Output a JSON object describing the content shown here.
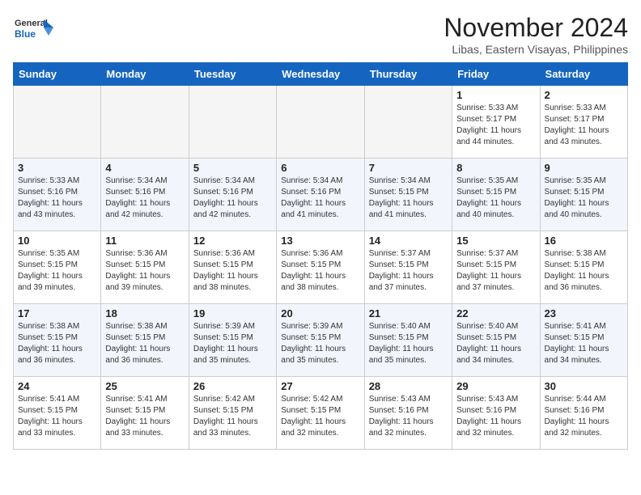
{
  "header": {
    "logo_general": "General",
    "logo_blue": "Blue",
    "month_title": "November 2024",
    "location": "Libas, Eastern Visayas, Philippines"
  },
  "weekdays": [
    "Sunday",
    "Monday",
    "Tuesday",
    "Wednesday",
    "Thursday",
    "Friday",
    "Saturday"
  ],
  "rows": [
    {
      "cells": [
        {
          "day": "",
          "info": ""
        },
        {
          "day": "",
          "info": ""
        },
        {
          "day": "",
          "info": ""
        },
        {
          "day": "",
          "info": ""
        },
        {
          "day": "",
          "info": ""
        },
        {
          "day": "1",
          "info": "Sunrise: 5:33 AM\nSunset: 5:17 PM\nDaylight: 11 hours\nand 44 minutes."
        },
        {
          "day": "2",
          "info": "Sunrise: 5:33 AM\nSunset: 5:17 PM\nDaylight: 11 hours\nand 43 minutes."
        }
      ]
    },
    {
      "cells": [
        {
          "day": "3",
          "info": "Sunrise: 5:33 AM\nSunset: 5:16 PM\nDaylight: 11 hours\nand 43 minutes."
        },
        {
          "day": "4",
          "info": "Sunrise: 5:34 AM\nSunset: 5:16 PM\nDaylight: 11 hours\nand 42 minutes."
        },
        {
          "day": "5",
          "info": "Sunrise: 5:34 AM\nSunset: 5:16 PM\nDaylight: 11 hours\nand 42 minutes."
        },
        {
          "day": "6",
          "info": "Sunrise: 5:34 AM\nSunset: 5:16 PM\nDaylight: 11 hours\nand 41 minutes."
        },
        {
          "day": "7",
          "info": "Sunrise: 5:34 AM\nSunset: 5:15 PM\nDaylight: 11 hours\nand 41 minutes."
        },
        {
          "day": "8",
          "info": "Sunrise: 5:35 AM\nSunset: 5:15 PM\nDaylight: 11 hours\nand 40 minutes."
        },
        {
          "day": "9",
          "info": "Sunrise: 5:35 AM\nSunset: 5:15 PM\nDaylight: 11 hours\nand 40 minutes."
        }
      ]
    },
    {
      "cells": [
        {
          "day": "10",
          "info": "Sunrise: 5:35 AM\nSunset: 5:15 PM\nDaylight: 11 hours\nand 39 minutes."
        },
        {
          "day": "11",
          "info": "Sunrise: 5:36 AM\nSunset: 5:15 PM\nDaylight: 11 hours\nand 39 minutes."
        },
        {
          "day": "12",
          "info": "Sunrise: 5:36 AM\nSunset: 5:15 PM\nDaylight: 11 hours\nand 38 minutes."
        },
        {
          "day": "13",
          "info": "Sunrise: 5:36 AM\nSunset: 5:15 PM\nDaylight: 11 hours\nand 38 minutes."
        },
        {
          "day": "14",
          "info": "Sunrise: 5:37 AM\nSunset: 5:15 PM\nDaylight: 11 hours\nand 37 minutes."
        },
        {
          "day": "15",
          "info": "Sunrise: 5:37 AM\nSunset: 5:15 PM\nDaylight: 11 hours\nand 37 minutes."
        },
        {
          "day": "16",
          "info": "Sunrise: 5:38 AM\nSunset: 5:15 PM\nDaylight: 11 hours\nand 36 minutes."
        }
      ]
    },
    {
      "cells": [
        {
          "day": "17",
          "info": "Sunrise: 5:38 AM\nSunset: 5:15 PM\nDaylight: 11 hours\nand 36 minutes."
        },
        {
          "day": "18",
          "info": "Sunrise: 5:38 AM\nSunset: 5:15 PM\nDaylight: 11 hours\nand 36 minutes."
        },
        {
          "day": "19",
          "info": "Sunrise: 5:39 AM\nSunset: 5:15 PM\nDaylight: 11 hours\nand 35 minutes."
        },
        {
          "day": "20",
          "info": "Sunrise: 5:39 AM\nSunset: 5:15 PM\nDaylight: 11 hours\nand 35 minutes."
        },
        {
          "day": "21",
          "info": "Sunrise: 5:40 AM\nSunset: 5:15 PM\nDaylight: 11 hours\nand 35 minutes."
        },
        {
          "day": "22",
          "info": "Sunrise: 5:40 AM\nSunset: 5:15 PM\nDaylight: 11 hours\nand 34 minutes."
        },
        {
          "day": "23",
          "info": "Sunrise: 5:41 AM\nSunset: 5:15 PM\nDaylight: 11 hours\nand 34 minutes."
        }
      ]
    },
    {
      "cells": [
        {
          "day": "24",
          "info": "Sunrise: 5:41 AM\nSunset: 5:15 PM\nDaylight: 11 hours\nand 33 minutes."
        },
        {
          "day": "25",
          "info": "Sunrise: 5:41 AM\nSunset: 5:15 PM\nDaylight: 11 hours\nand 33 minutes."
        },
        {
          "day": "26",
          "info": "Sunrise: 5:42 AM\nSunset: 5:15 PM\nDaylight: 11 hours\nand 33 minutes."
        },
        {
          "day": "27",
          "info": "Sunrise: 5:42 AM\nSunset: 5:15 PM\nDaylight: 11 hours\nand 32 minutes."
        },
        {
          "day": "28",
          "info": "Sunrise: 5:43 AM\nSunset: 5:16 PM\nDaylight: 11 hours\nand 32 minutes."
        },
        {
          "day": "29",
          "info": "Sunrise: 5:43 AM\nSunset: 5:16 PM\nDaylight: 11 hours\nand 32 minutes."
        },
        {
          "day": "30",
          "info": "Sunrise: 5:44 AM\nSunset: 5:16 PM\nDaylight: 11 hours\nand 32 minutes."
        }
      ]
    }
  ]
}
